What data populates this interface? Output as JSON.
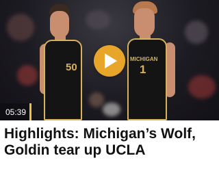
{
  "video": {
    "duration": "05:39",
    "play_icon": "play-icon",
    "accent_color": "#e7a52a",
    "jersey_numbers": [
      "50",
      "1"
    ],
    "jersey_text": "MICHIGAN"
  },
  "headline": {
    "text": "Highlights: Michigan’s Wolf, Goldin tear up UCLA"
  }
}
